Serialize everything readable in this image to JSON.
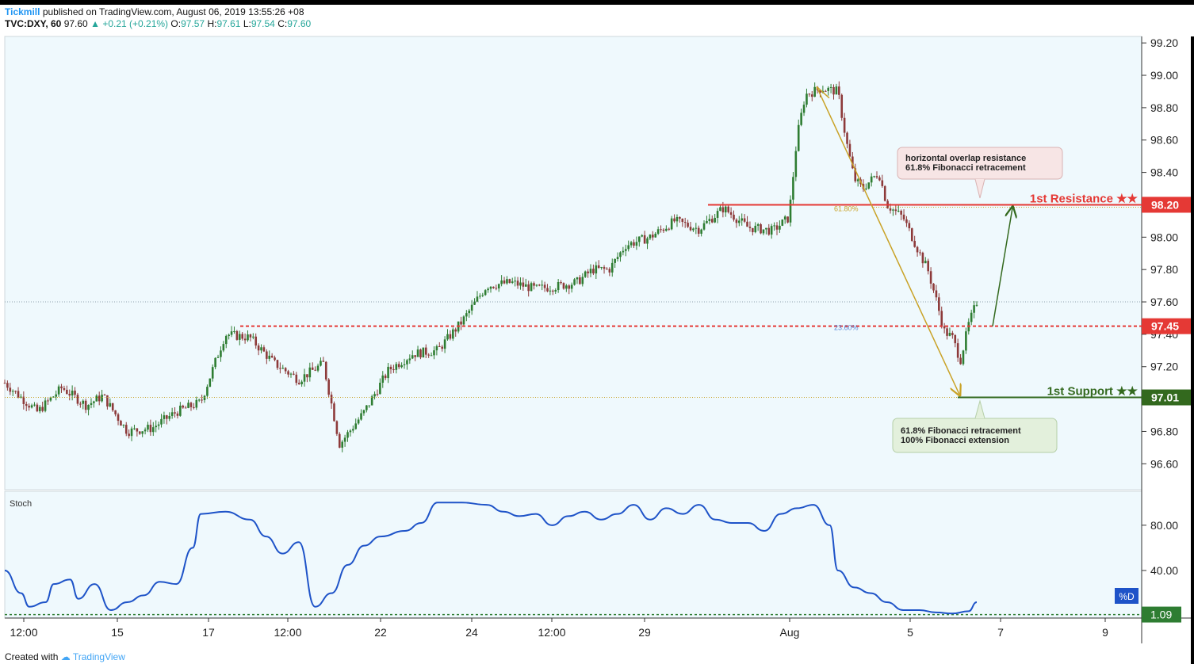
{
  "header": {
    "publisher": "Tickmill",
    "published_text": "published on TradingView.com, August 06, 2019 13:55:26 +08",
    "symbol": "TVC:DXY, 60",
    "last": "97.60",
    "change": "+0.21 (+0.21%)",
    "o_label": "O:",
    "o": "97.57",
    "h_label": "H:",
    "h": "97.61",
    "l_label": "L:",
    "l": "97.54",
    "c_label": "C:",
    "c": "97.60"
  },
  "footer": {
    "created_with": "Created with",
    "brand": "TradingView"
  },
  "colors": {
    "plot_bg": "#eff9fd",
    "resistance": "#e53935",
    "support": "#33691e",
    "fib_arrow": "#c9a227",
    "stoch_line": "#1e53c8",
    "candle_up": "#2e7d32",
    "candle_down": "#8d3a3a"
  },
  "chart_data": {
    "type": "candlestick",
    "price_axis": {
      "ylim": [
        96.44,
        99.24
      ],
      "ticks": [
        "96.60",
        "96.80",
        "97.00",
        "97.20",
        "97.40",
        "97.60",
        "97.80",
        "98.00",
        "98.20",
        "98.40",
        "98.60",
        "98.80",
        "99.00",
        "99.20"
      ]
    },
    "time_axis": {
      "labels": [
        "12:00",
        "15",
        "17",
        "12:00",
        "22",
        "24",
        "12:00",
        "29",
        "Aug",
        "5",
        "7",
        "9"
      ]
    },
    "price_path": [
      [
        0,
        97.1
      ],
      [
        4,
        96.92
      ],
      [
        7,
        97.07
      ],
      [
        10,
        96.96
      ],
      [
        12,
        97.02
      ],
      [
        15,
        96.8
      ],
      [
        18,
        96.82
      ],
      [
        21,
        96.92
      ],
      [
        24,
        96.98
      ],
      [
        27,
        97.4
      ],
      [
        30,
        97.38
      ],
      [
        33,
        97.22
      ],
      [
        36,
        97.12
      ],
      [
        39,
        97.22
      ],
      [
        41,
        96.72
      ],
      [
        44,
        96.92
      ],
      [
        47,
        97.18
      ],
      [
        50,
        97.28
      ],
      [
        53,
        97.3
      ],
      [
        56,
        97.48
      ],
      [
        59,
        97.7
      ],
      [
        62,
        97.72
      ],
      [
        65,
        97.68
      ],
      [
        68,
        97.7
      ],
      [
        70,
        97.72
      ],
      [
        72,
        97.8
      ],
      [
        74,
        97.8
      ],
      [
        76,
        97.95
      ],
      [
        79,
        98.0
      ],
      [
        82,
        98.1
      ],
      [
        85,
        98.05
      ],
      [
        88,
        98.18
      ],
      [
        91,
        98.06
      ],
      [
        94,
        98.04
      ],
      [
        96,
        98.12
      ],
      [
        97,
        98.62
      ],
      [
        98,
        98.88
      ],
      [
        100,
        98.92
      ],
      [
        102,
        98.9
      ],
      [
        103,
        98.6
      ],
      [
        104,
        98.36
      ],
      [
        105,
        98.3
      ],
      [
        107,
        98.4
      ],
      [
        108,
        98.2
      ],
      [
        110,
        98.12
      ],
      [
        112,
        97.9
      ],
      [
        113,
        97.8
      ],
      [
        114,
        97.62
      ],
      [
        115,
        97.42
      ],
      [
        116,
        97.38
      ],
      [
        117,
        97.24
      ],
      [
        118,
        97.46
      ],
      [
        119,
        97.6
      ]
    ],
    "levels": [
      {
        "name": "1st Resistance ★★",
        "value": 98.2,
        "value_label": "98.20"
      },
      {
        "name": "",
        "value": 97.45,
        "value_label": "97.45"
      },
      {
        "name": "1st Support ★★",
        "value": 97.01,
        "value_label": "97.01"
      }
    ],
    "current_price": 97.6,
    "fib_labels": [
      "61.80%",
      "23.60%"
    ],
    "annotations": [
      {
        "lines": [
          "horizontal overlap resistance",
          "61.8% Fibonacci retracement"
        ]
      },
      {
        "lines": [
          "61.8% Fibonacci retracement",
          "100% Fibonacci extension"
        ]
      }
    ],
    "stoch": {
      "title": "Stoch",
      "ylim": [
        -2,
        110
      ],
      "ticks": [
        "40.00",
        "80.00"
      ],
      "last_value": "1.09",
      "series_label": "%D",
      "values": [
        [
          0,
          40
        ],
        [
          2,
          20
        ],
        [
          3,
          8
        ],
        [
          5,
          12
        ],
        [
          6,
          28
        ],
        [
          8,
          32
        ],
        [
          9,
          15
        ],
        [
          11,
          28
        ],
        [
          13,
          5
        ],
        [
          15,
          12
        ],
        [
          17,
          18
        ],
        [
          19,
          30
        ],
        [
          21,
          28
        ],
        [
          23,
          60
        ],
        [
          24,
          90
        ],
        [
          27,
          92
        ],
        [
          30,
          85
        ],
        [
          32,
          70
        ],
        [
          34,
          55
        ],
        [
          36,
          65
        ],
        [
          38,
          8
        ],
        [
          40,
          20
        ],
        [
          42,
          45
        ],
        [
          44,
          62
        ],
        [
          46,
          70
        ],
        [
          49,
          75
        ],
        [
          51,
          82
        ],
        [
          53,
          100
        ],
        [
          56,
          100
        ],
        [
          59,
          98
        ],
        [
          61,
          92
        ],
        [
          63,
          88
        ],
        [
          65,
          90
        ],
        [
          67,
          80
        ],
        [
          69,
          88
        ],
        [
          71,
          92
        ],
        [
          73,
          85
        ],
        [
          75,
          90
        ],
        [
          77,
          98
        ],
        [
          79,
          85
        ],
        [
          81,
          95
        ],
        [
          83,
          90
        ],
        [
          85,
          98
        ],
        [
          87,
          85
        ],
        [
          89,
          82
        ],
        [
          91,
          82
        ],
        [
          93,
          75
        ],
        [
          95,
          90
        ],
        [
          97,
          95
        ],
        [
          99,
          98
        ],
        [
          101,
          80
        ],
        [
          102,
          40
        ],
        [
          104,
          25
        ],
        [
          106,
          20
        ],
        [
          108,
          12
        ],
        [
          110,
          5
        ],
        [
          112,
          5
        ],
        [
          114,
          3
        ],
        [
          116,
          2
        ],
        [
          118,
          4
        ],
        [
          119,
          12
        ]
      ]
    }
  }
}
